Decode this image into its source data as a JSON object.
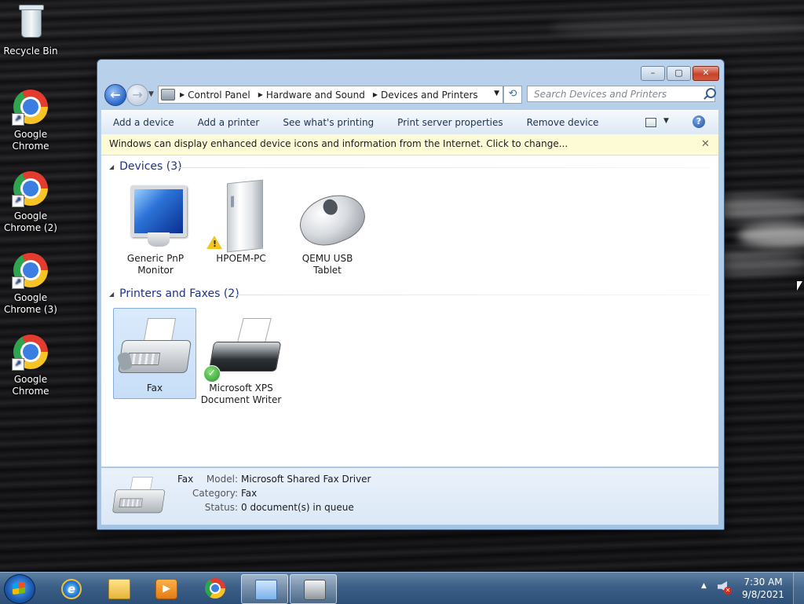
{
  "desktop": {
    "icons": [
      {
        "label": "Recycle Bin",
        "icon": "recycle-bin-icon"
      },
      {
        "label": "Google Chrome",
        "icon": "chrome-icon"
      },
      {
        "label": "Google Chrome (2)",
        "icon": "chrome-icon"
      },
      {
        "label": "Google Chrome (3)",
        "icon": "chrome-icon"
      },
      {
        "label": "Google Chrome",
        "icon": "chrome-icon"
      }
    ]
  },
  "window": {
    "controls": {
      "minimize": "–",
      "maximize": "▢",
      "close": "✕"
    },
    "address": {
      "crumbs": [
        "Control Panel",
        "Hardware and Sound",
        "Devices and Printers"
      ],
      "separator": "▶"
    },
    "search": {
      "placeholder": "Search Devices and Printers"
    },
    "commands": [
      "Add a device",
      "Add a printer",
      "See what's printing",
      "Print server properties",
      "Remove device"
    ],
    "infobar": {
      "text": "Windows can display enhanced device icons and information from the Internet. Click to change...",
      "close": "✕"
    },
    "groups": {
      "devices": {
        "header": "Devices (3)",
        "items": [
          {
            "name": "Generic PnP Monitor",
            "icon": "monitor-icon"
          },
          {
            "name": "HPOEM-PC",
            "icon": "computer-tower-icon",
            "badge": "warning-icon"
          },
          {
            "name": "QEMU USB Tablet",
            "icon": "mouse-icon"
          }
        ]
      },
      "printers": {
        "header": "Printers and Faxes (2)",
        "items": [
          {
            "name": "Fax",
            "icon": "fax-icon",
            "selected": true
          },
          {
            "name": "Microsoft XPS Document Writer",
            "icon": "printer-icon",
            "badge": "default-check-icon"
          }
        ]
      }
    },
    "details": {
      "name": "Fax",
      "fields": [
        {
          "label": "Model:",
          "value": "Microsoft Shared Fax Driver"
        },
        {
          "label": "Category:",
          "value": "Fax"
        },
        {
          "label": "Status:",
          "value": "0 document(s) in queue"
        }
      ]
    }
  },
  "taskbar": {
    "pinned": [
      "internet-explorer-icon",
      "windows-explorer-icon",
      "media-player-icon",
      "chrome-icon",
      "control-panel-icon",
      "fax-icon"
    ],
    "clock": {
      "time": "7:30 AM",
      "date": "9/8/2021"
    }
  },
  "colors": {
    "accent": "#1e3287",
    "infobar": "#fdfbd5",
    "selection": "#c7def8"
  }
}
